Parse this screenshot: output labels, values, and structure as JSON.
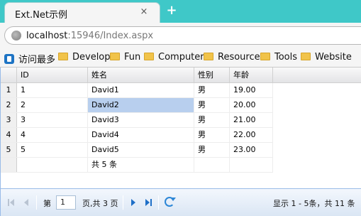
{
  "browser": {
    "tab_title": "Ext.Net示例",
    "tab_close": "×",
    "new_tab": "+",
    "url_host": "localhost",
    "url_rest": ":15946/Index.aspx"
  },
  "bookmarks": [
    "访问最多",
    "Develop",
    "Fun",
    "Computer",
    "Resource",
    "Tools",
    "Website"
  ],
  "grid": {
    "columns": [
      "ID",
      "姓名",
      "性别",
      "年龄"
    ],
    "rows": [
      {
        "num": "1",
        "id": "1",
        "name": "David1",
        "gender": "男",
        "age": "19.00"
      },
      {
        "num": "2",
        "id": "2",
        "name": "David2",
        "gender": "男",
        "age": "20.00"
      },
      {
        "num": "3",
        "id": "3",
        "name": "David3",
        "gender": "男",
        "age": "21.00"
      },
      {
        "num": "4",
        "id": "4",
        "name": "David4",
        "gender": "男",
        "age": "22.00"
      },
      {
        "num": "5",
        "id": "5",
        "name": "David5",
        "gender": "男",
        "age": "23.00"
      }
    ],
    "summary": "共 5 条",
    "selected_row": 2
  },
  "pager": {
    "page_label": "第",
    "page_value": "1",
    "page_total": "页,共 3 页",
    "display_info": "显示 1 - 5条，共 11 条"
  },
  "colors": {
    "titlebar": "#3fc8c8",
    "selected": "#b8cfee",
    "accent": "#1e6fc7"
  }
}
